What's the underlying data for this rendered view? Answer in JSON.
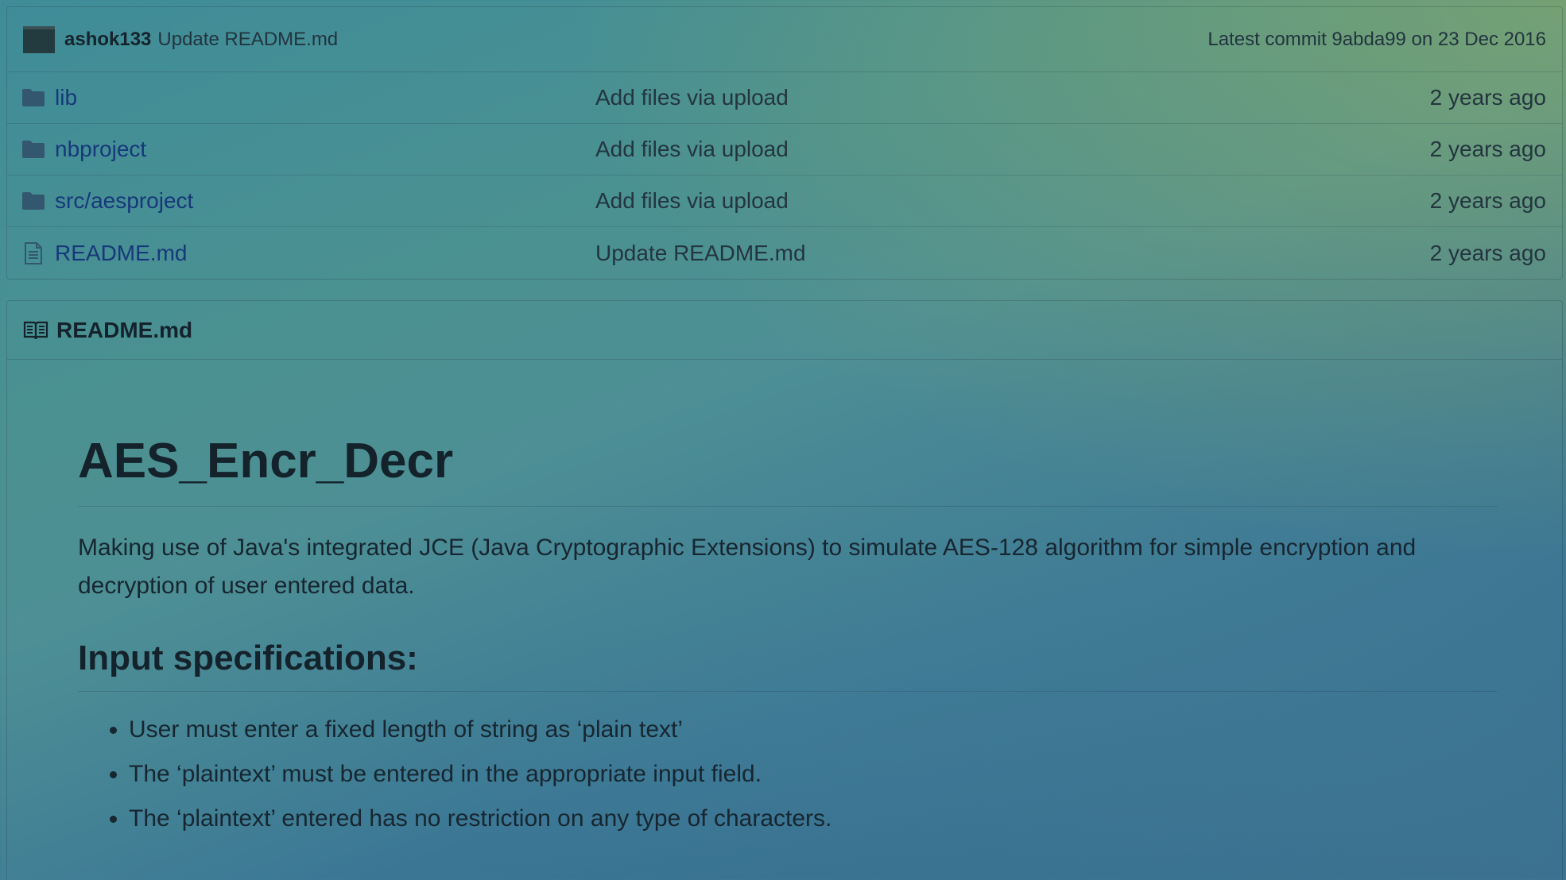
{
  "commit": {
    "author": "ashok133",
    "message": "Update README.md",
    "latest_prefix": "Latest commit",
    "sha": "9abda99",
    "date_text": "on 23 Dec 2016"
  },
  "files": [
    {
      "type": "folder",
      "name": "lib",
      "message": "Add files via upload",
      "age": "2 years ago"
    },
    {
      "type": "folder",
      "name": "nbproject",
      "message": "Add files via upload",
      "age": "2 years ago"
    },
    {
      "type": "folder",
      "name": "src/aesproject",
      "message": "Add files via upload",
      "age": "2 years ago"
    },
    {
      "type": "file",
      "name": "README.md",
      "message": "Update README.md",
      "age": "2 years ago"
    }
  ],
  "readme": {
    "header": "README.md",
    "title": "AES_Encr_Decr",
    "description": "Making use of Java's integrated JCE (Java Cryptographic Extensions) to simulate AES-128 algorithm for simple encryption and decryption of user entered data.",
    "section_title": "Input specifications:",
    "bullets": [
      "User must enter a fixed length of string as ‘plain text’",
      "The ‘plaintext’ must be entered in the appropriate input field.",
      "The ‘plaintext’ entered has no restriction on any type of characters."
    ]
  },
  "colors": {
    "link": "#17387a",
    "icon": "#33576e"
  }
}
